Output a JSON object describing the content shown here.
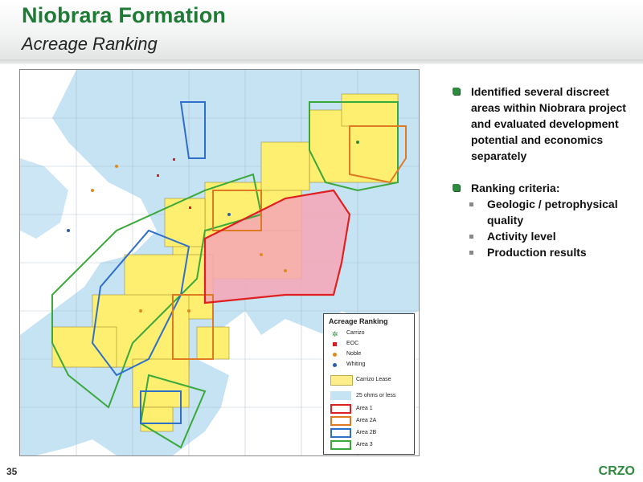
{
  "header": {
    "title": "Niobrara Formation",
    "subtitle": "Acreage Ranking"
  },
  "bullets": [
    {
      "text": "Identified several discreet areas within Niobrara project and evaluated development potential and economics separately",
      "sub": []
    },
    {
      "text": "Ranking criteria:",
      "sub": [
        "Geologic / petrophysical quality",
        "Activity level",
        "Production results"
      ]
    }
  ],
  "legend": {
    "title": "Acreage Ranking",
    "items": [
      {
        "label": "Carrizo",
        "icon": "sun-symbol",
        "color": "#2e8b3e"
      },
      {
        "label": "EOC",
        "icon": "square-symbol",
        "color": "#d42020"
      },
      {
        "label": "Noble",
        "icon": "circle-symbol",
        "color": "#e08a1e"
      },
      {
        "label": "Whiting",
        "icon": "circle-symbol",
        "color": "#2a5fb0"
      },
      {
        "label": "Carrizo Lease",
        "icon": "fill-box",
        "color": "#ffef8a"
      },
      {
        "label": "25 ohms or less",
        "icon": "fill-box",
        "color": "#c6e3f4"
      },
      {
        "label": "Area 1",
        "icon": "outline-box",
        "color": "#e02020"
      },
      {
        "label": "Area 2A",
        "icon": "outline-box",
        "color": "#e07a22"
      },
      {
        "label": "Area 2B",
        "icon": "outline-box",
        "color": "#2f6fc9"
      },
      {
        "label": "Area 3",
        "icon": "outline-box",
        "color": "#3aa83a"
      }
    ]
  },
  "colors": {
    "title_green": "#1f7a36",
    "water_blue": "#c6e3f4",
    "lease_yellow": "#ffef70",
    "area1_red": "#e02020",
    "area2a_orange": "#e07a22",
    "area2b_blue": "#2f6fc9",
    "area3_green": "#3aa83a"
  },
  "footer": {
    "page_number": "35",
    "brand": "CRZO"
  }
}
